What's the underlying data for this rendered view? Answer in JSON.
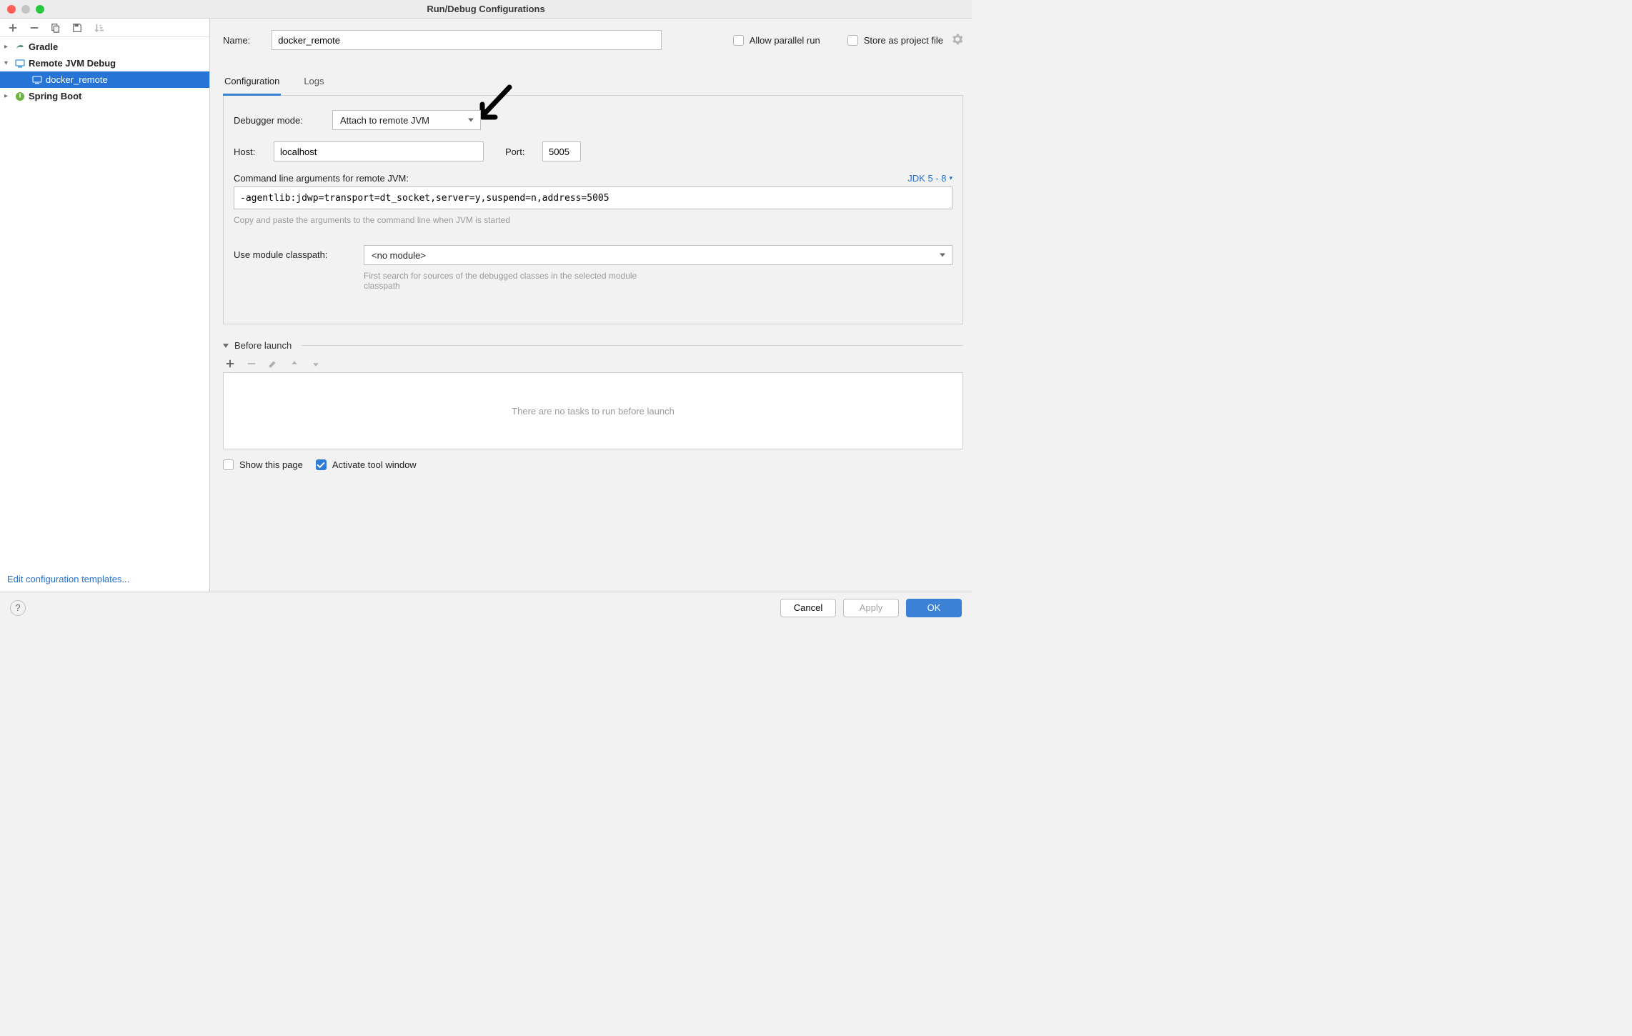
{
  "window": {
    "title": "Run/Debug Configurations"
  },
  "toolbar": {
    "add": "+",
    "remove": "−",
    "copy": "copy",
    "save_template": "save",
    "sort": "sort"
  },
  "tree": {
    "items": [
      {
        "label": "Gradle",
        "bold": true,
        "expanded": false,
        "icon": "gradle"
      },
      {
        "label": "Remote JVM Debug",
        "bold": true,
        "expanded": true,
        "icon": "remote"
      },
      {
        "label": "docker_remote",
        "bold": false,
        "selected": true,
        "indent": 2,
        "icon": "remote"
      },
      {
        "label": "Spring Boot",
        "bold": true,
        "expanded": false,
        "icon": "spring"
      }
    ],
    "edit_templates": "Edit configuration templates..."
  },
  "form": {
    "name_label": "Name:",
    "name_value": "docker_remote",
    "allow_parallel": "Allow parallel run",
    "store_project": "Store as project file"
  },
  "tabs": [
    {
      "label": "Configuration",
      "active": true
    },
    {
      "label": "Logs",
      "active": false
    }
  ],
  "config": {
    "debugger_mode_label": "Debugger mode:",
    "debugger_mode_value": "Attach to remote JVM",
    "host_label": "Host:",
    "host_value": "localhost",
    "port_label": "Port:",
    "port_value": "5005",
    "cmdline_label": "Command line arguments for remote JVM:",
    "jdk_link": "JDK 5 - 8",
    "cmdline_value": "-agentlib:jdwp=transport=dt_socket,server=y,suspend=n,address=5005",
    "cmdline_hint": "Copy and paste the arguments to the command line when JVM is started",
    "classpath_label": "Use module classpath:",
    "classpath_value": "<no module>",
    "classpath_hint": "First search for sources of the debugged classes in the selected module classpath"
  },
  "before_launch": {
    "title": "Before launch",
    "empty_text": "There are no tasks to run before launch",
    "show_page": "Show this page",
    "activate_tool": "Activate tool window"
  },
  "footer": {
    "cancel": "Cancel",
    "apply": "Apply",
    "ok": "OK"
  }
}
